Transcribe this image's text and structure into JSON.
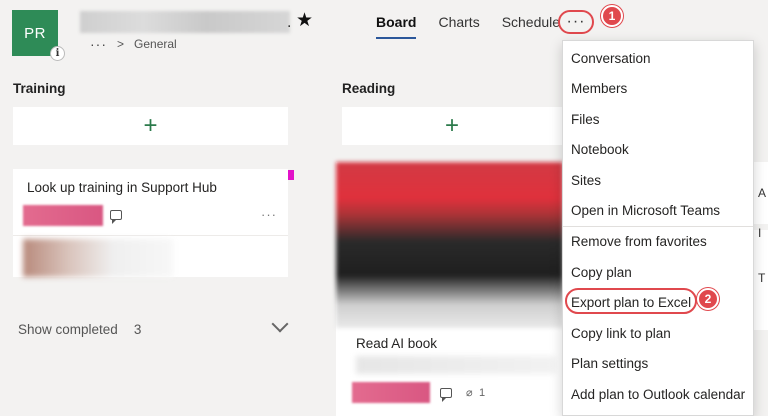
{
  "header": {
    "avatar_initials": "PR",
    "info_badge": "i",
    "plan_suffix": ".",
    "favorite_icon": "star-icon",
    "breadcrumb_ellipsis": "···",
    "breadcrumb_separator": ">",
    "breadcrumb_group": "General"
  },
  "tabs": [
    {
      "label": "Board",
      "active": true
    },
    {
      "label": "Charts",
      "active": false
    },
    {
      "label": "Schedule",
      "active": false
    }
  ],
  "more_button": "···",
  "steps": {
    "one": "1",
    "two": "2"
  },
  "buckets": {
    "training": {
      "title": "Training",
      "add_symbol": "+",
      "card_title": "Look up training in Support Hub",
      "card_more": "···",
      "show_completed_label": "Show completed",
      "show_completed_count": "3"
    },
    "reading": {
      "title": "Reading",
      "add_symbol": "+",
      "card_title": "Read AI book",
      "attachment_count": "1"
    }
  },
  "menu": {
    "items": [
      "Conversation",
      "Members",
      "Files",
      "Notebook",
      "Sites",
      "Open in Microsoft Teams",
      "Remove from favorites",
      "Copy plan",
      "Export plan to Excel",
      "Copy link to plan",
      "Plan settings",
      "Add plan to Outlook calendar"
    ]
  },
  "right_strip": {
    "letters": [
      "A",
      "I",
      "T"
    ]
  },
  "colors": {
    "avatar_bg": "#2e8b57",
    "highlight_red": "#e0484d",
    "accent_blue": "#2b579a",
    "label_pink": "#e36b8f",
    "tag_magenta": "#e213c9"
  }
}
